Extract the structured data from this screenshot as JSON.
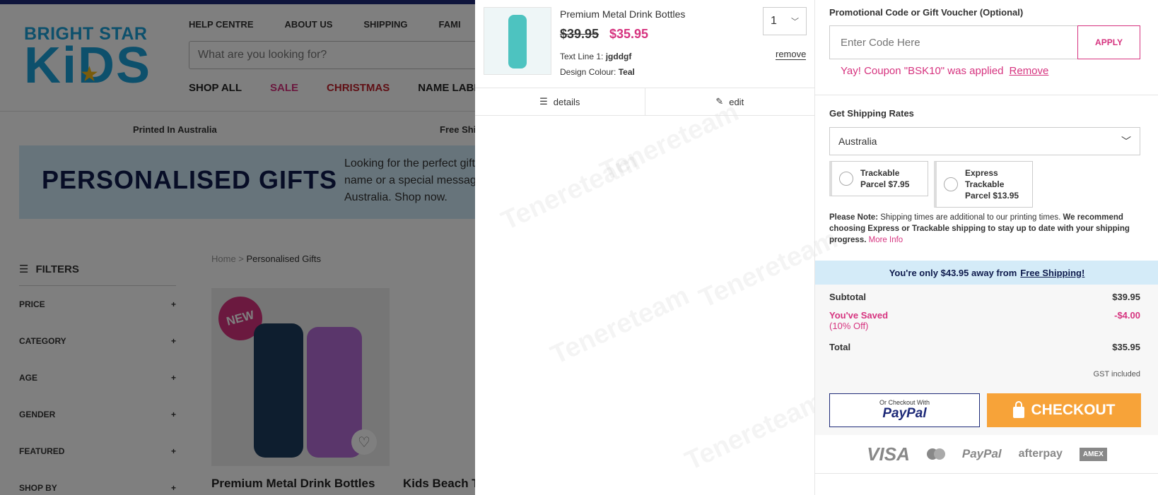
{
  "site": {
    "logo_top": "BRIGHT STAR",
    "logo_bottom": "KiDS",
    "topnav": [
      "HELP CENTRE",
      "ABOUT US",
      "SHIPPING",
      "FAMI"
    ],
    "search_placeholder": "What are you looking for?",
    "catnav": [
      "SHOP ALL",
      "SALE",
      "CHRISTMAS",
      "NAME LABE"
    ],
    "usp": [
      "Printed In Australia",
      "Free Shi"
    ],
    "banner_title": "PERSONALISED GIFTS",
    "banner_desc": "Looking for the perfect gift name or a special message Australia. Shop now.",
    "filters_label": "FILTERS",
    "filters": [
      "PRICE",
      "CATEGORY",
      "AGE",
      "GENDER",
      "FEATURED",
      "SHOP BY"
    ],
    "breadcrumb": {
      "home": "Home",
      "sep": " > ",
      "current": "Personalised Gifts"
    },
    "badge": "NEW",
    "products": [
      "Premium Metal Drink Bottles",
      "Kids Beach T"
    ]
  },
  "cart": {
    "item": {
      "name": "Premium Metal Drink Bottles",
      "old_price": "$39.95",
      "new_price": "$35.95",
      "quantity": "1",
      "remove": "remove",
      "text_line_label": "Text Line 1:",
      "text_line_value": "jgddgf",
      "colour_label": "Design Colour:",
      "colour_value": "Teal",
      "details": "details",
      "edit": "edit"
    },
    "promo": {
      "label": "Promotional Code or Gift Voucher (Optional)",
      "placeholder": "Enter Code Here",
      "apply": "APPLY",
      "applied": "Yay! Coupon \"BSK10\" was applied",
      "remove": "Remove"
    },
    "shipping": {
      "label": "Get Shipping Rates",
      "country": "Australia",
      "option1": "Trackable Parcel $7.95",
      "option2": "Express Trackable Parcel $13.95",
      "note_bold": "Please Note:",
      "note_text": " Shipping times are additional to our printing times. ",
      "note_bold2": "We recommend choosing Express or Trackable shipping to stay up to date with your shipping progress.",
      "more_info": "More Info"
    },
    "free_shipping": {
      "text": "You're only $43.95 away from",
      "link": "Free Shipping!"
    },
    "totals": {
      "subtotal_label": "Subtotal",
      "subtotal": "$39.95",
      "saved_label": "You've Saved",
      "saved_sub": "(10% Off)",
      "saved": "-$4.00",
      "total_label": "Total",
      "total": "$35.95",
      "gst": "GST included"
    },
    "buttons": {
      "paypal_small": "Or Checkout With",
      "paypal": "PayPal",
      "checkout": "CHECKOUT"
    },
    "payment_logos": [
      "VISA",
      "PayPal",
      "afterpay",
      "AMEX"
    ],
    "watermark": "Tenereteam"
  },
  "colors": {
    "accent": "#d6337f",
    "navy": "#1e2a78",
    "checkout": "#f7a339",
    "brand_blue": "#1aa0d8"
  }
}
